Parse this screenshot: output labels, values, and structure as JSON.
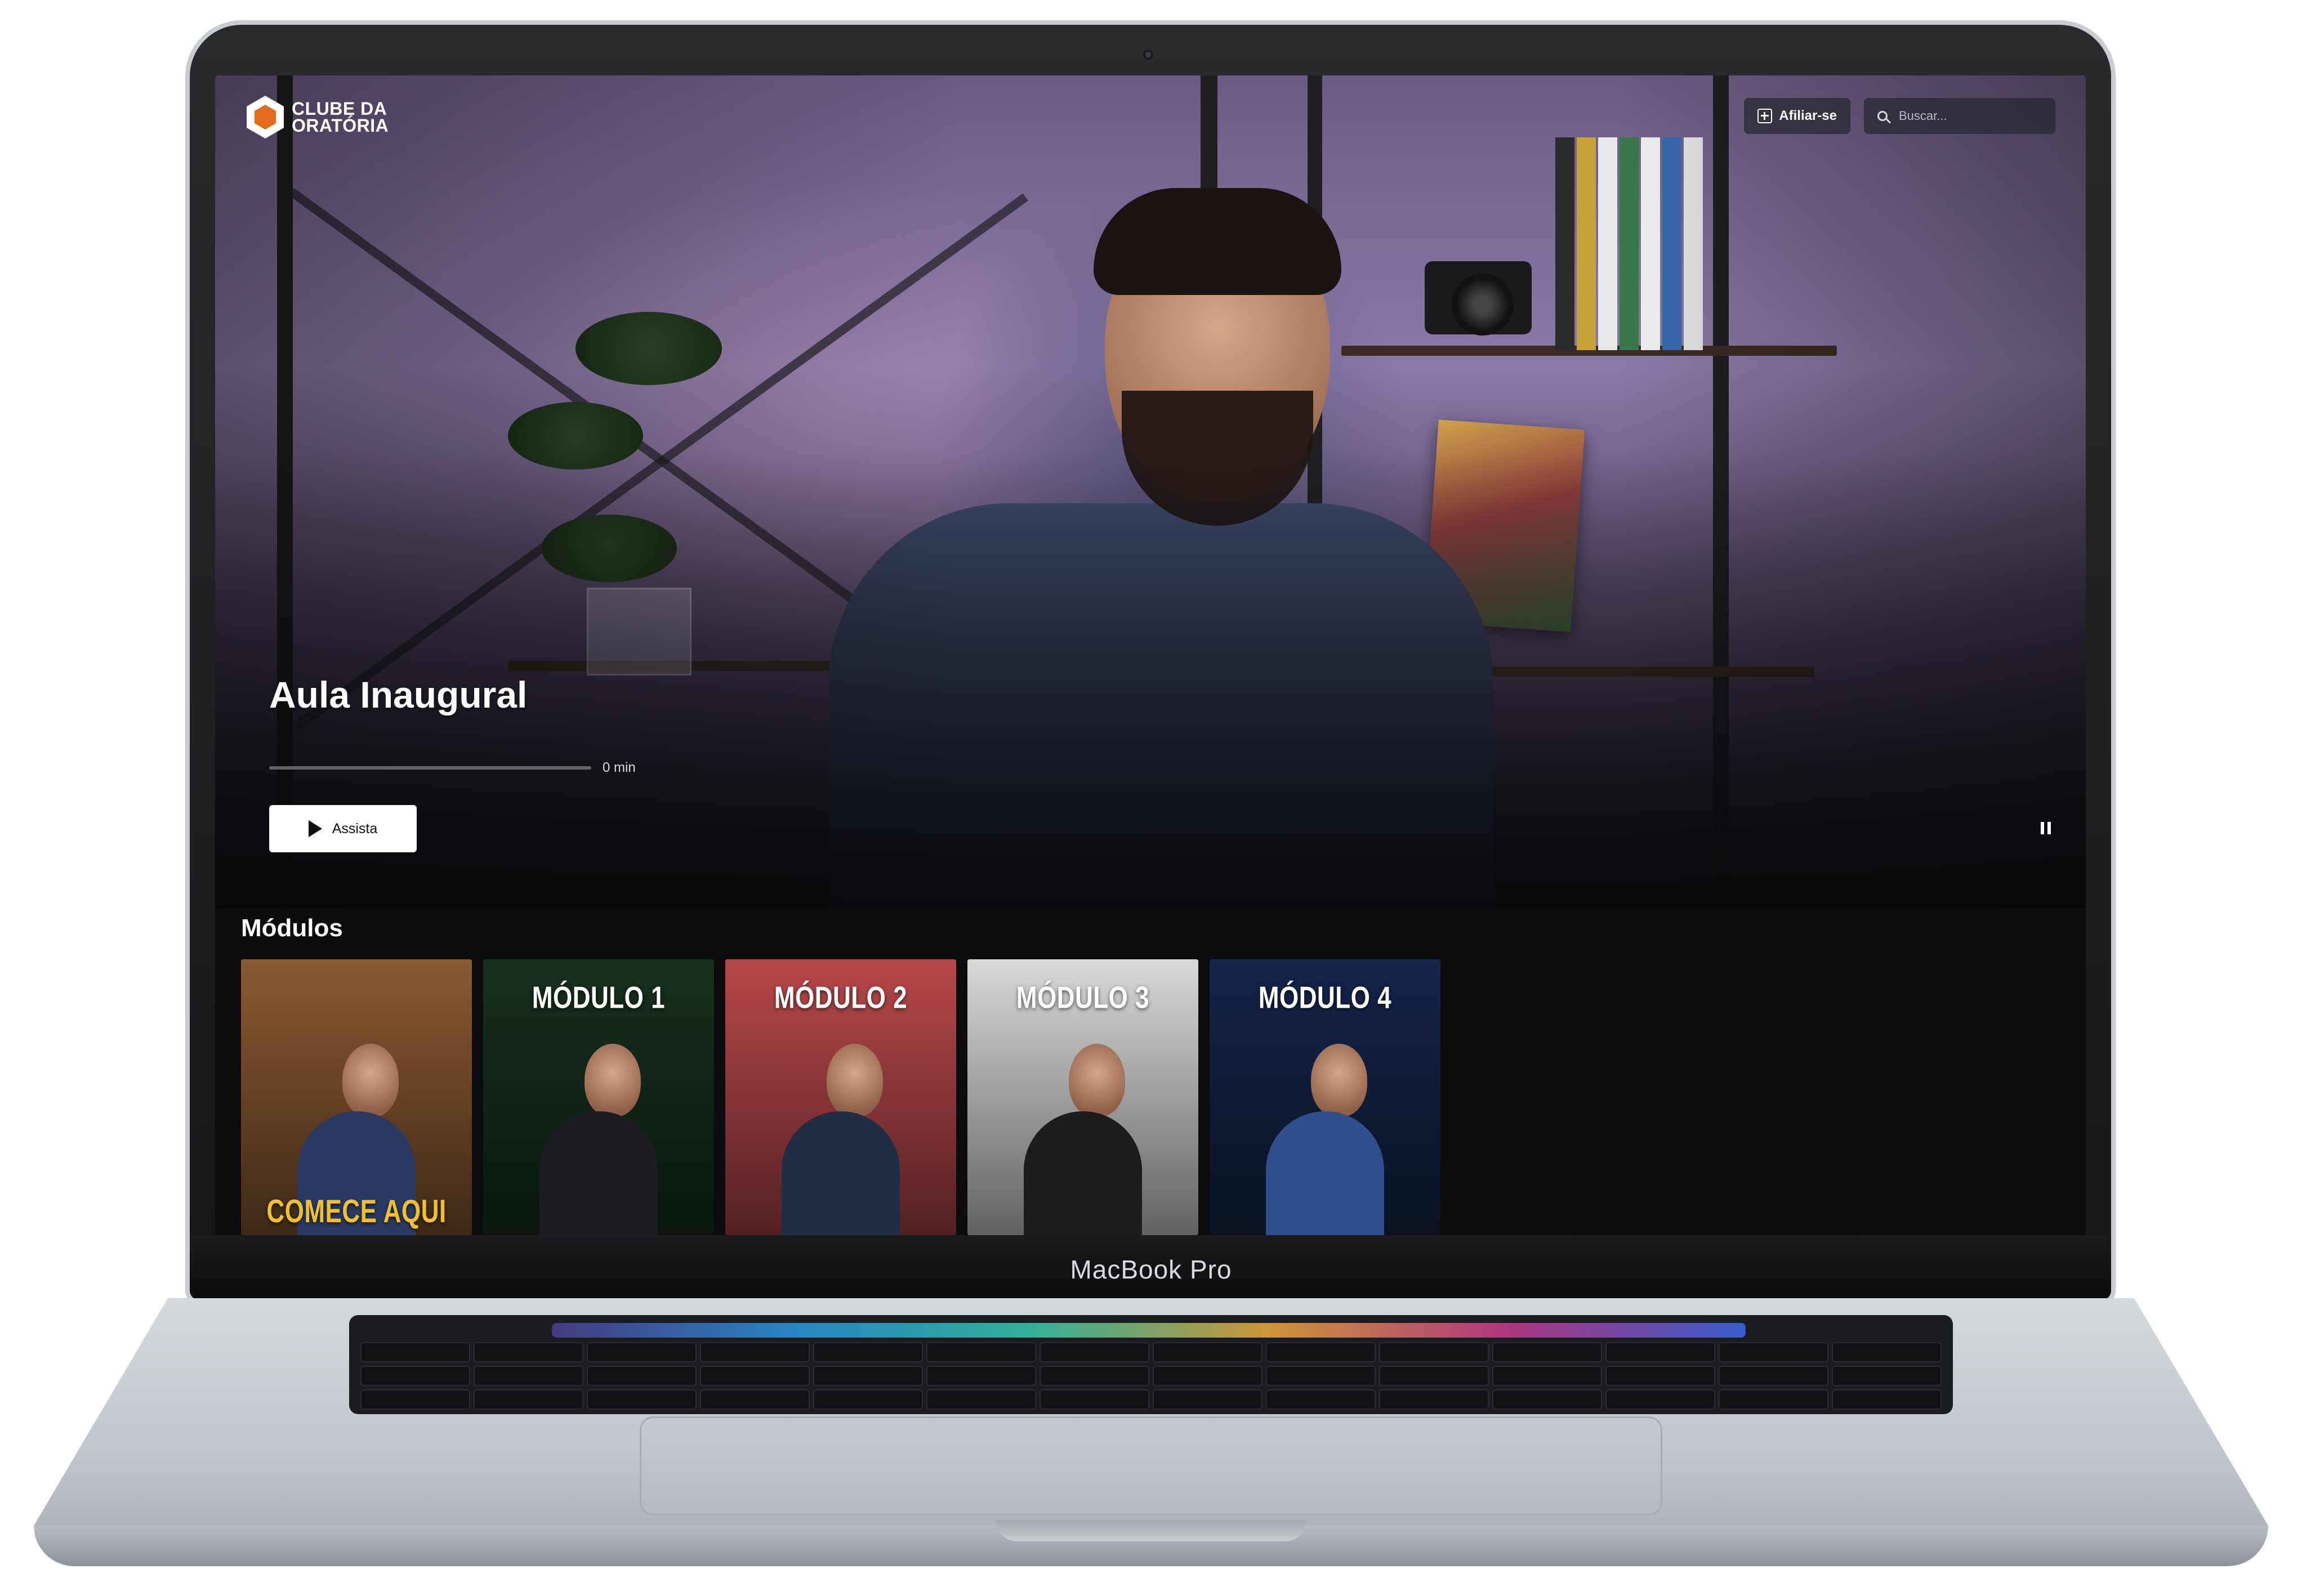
{
  "device": {
    "brand_label": "MacBook Pro"
  },
  "app": {
    "logo_line1": "CLUBE DA",
    "logo_line2": "ORATÓRIA",
    "header": {
      "affiliate_label": "Afiliar-se",
      "search_placeholder": "Buscar..."
    }
  },
  "hero": {
    "title": "Aula Inaugural",
    "progress_label": "0 min",
    "progress_fraction": 0,
    "watch_label": "Assista"
  },
  "modules": {
    "title": "Módulos",
    "items": [
      {
        "label": "COMECE AQUI",
        "position": "bottom",
        "bg": "#8a5a32"
      },
      {
        "label": "MÓDULO 1",
        "position": "top",
        "bg": "#16301f"
      },
      {
        "label": "MÓDULO 2",
        "position": "top",
        "bg": "#b8484a"
      },
      {
        "label": "MÓDULO 3",
        "position": "top",
        "bg": "#d9d9d9"
      },
      {
        "label": "MÓDULO 4",
        "position": "top",
        "bg": "#14254a"
      }
    ]
  },
  "colors": {
    "accent": "#e56a1e",
    "gold_label": "#f0c12a"
  }
}
